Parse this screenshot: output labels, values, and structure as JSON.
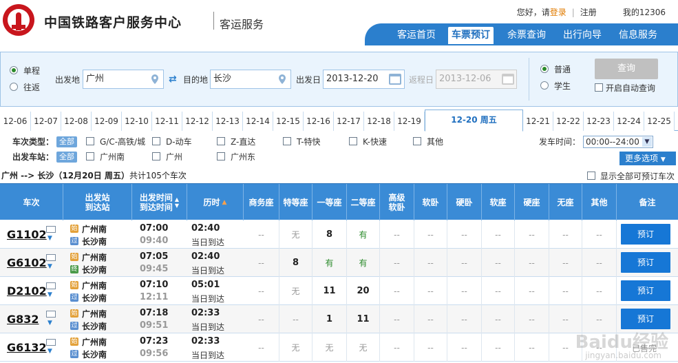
{
  "header": {
    "site_title": "中国铁路客户服务中心",
    "site_sub": "客运服务",
    "greeting": "您好，请",
    "login": "登录",
    "register": "注册",
    "my_account": "我的12306",
    "nav": [
      "客运首页",
      "车票预订",
      "余票查询",
      "出行向导",
      "信息服务"
    ],
    "active_nav": "车票预订"
  },
  "query": {
    "trip_oneway": "单程",
    "trip_round": "往返",
    "from_label": "出发地",
    "from_value": "广州",
    "to_label": "目的地",
    "to_value": "长沙",
    "date_label": "出发日",
    "date_value": "2013-12-20",
    "return_label": "返程日",
    "return_value": "2013-12-06",
    "type_normal": "普通",
    "type_student": "学生",
    "query_button": "查询",
    "auto_query": "开启自动查询"
  },
  "dates": [
    "12-06",
    "12-07",
    "12-08",
    "12-09",
    "12-10",
    "12-11",
    "12-12",
    "12-13",
    "12-14",
    "12-15",
    "12-16",
    "12-17",
    "12-18",
    "12-19",
    "12-20 周五",
    "12-21",
    "12-22",
    "12-23",
    "12-24",
    "12-25"
  ],
  "active_date": "12-20 周五",
  "filters": {
    "type_label": "车次类型：",
    "station_label": "出发车站：",
    "all": "全部",
    "types": [
      "G/C-高铁/城",
      "D-动车",
      "Z-直达",
      "T-特快",
      "K-快速",
      "其他"
    ],
    "stations": [
      "广州南",
      "广州",
      "广州东"
    ],
    "time_label": "发车时间：",
    "time_value": "00:00--24:00",
    "more": "更多选项"
  },
  "summary": {
    "route": "广州 --> 长沙（12月20日  周五）",
    "count": "共计105个车次",
    "show_all": "显示全部可预订车次"
  },
  "table": {
    "headers": {
      "train": "车次",
      "station": "出发站\n到达站",
      "time": "出发时间\n到达时间",
      "duration": "历时",
      "business": "商务座",
      "special": "特等座",
      "first": "一等座",
      "second": "二等座",
      "adv_soft": "高级\n软卧",
      "soft_sleep": "软卧",
      "hard_sleep": "硬卧",
      "soft_seat": "软座",
      "hard_seat": "硬座",
      "no_seat": "无座",
      "other": "其他",
      "remark": "备注"
    },
    "rows": [
      {
        "train": "G1102",
        "from": "广州南",
        "to": "长沙南",
        "from_badge": "始",
        "to_badge": "过",
        "dep": "07:00",
        "arr": "09:40",
        "duration": "02:40",
        "dur_note": "当日到达",
        "seats": [
          "--",
          "无",
          "8",
          "有",
          "--",
          "--",
          "--",
          "--",
          "--",
          "--",
          "--"
        ],
        "action": "预订"
      },
      {
        "train": "G6102",
        "from": "广州南",
        "to": "长沙南",
        "from_badge": "始",
        "to_badge": "终",
        "dep": "07:05",
        "arr": "09:45",
        "duration": "02:40",
        "dur_note": "当日到达",
        "seats": [
          "--",
          "8",
          "有",
          "有",
          "--",
          "--",
          "--",
          "--",
          "--",
          "--",
          "--"
        ],
        "action": "预订"
      },
      {
        "train": "D2102",
        "from": "广州南",
        "to": "长沙南",
        "from_badge": "始",
        "to_badge": "过",
        "dep": "07:10",
        "arr": "12:11",
        "duration": "05:01",
        "dur_note": "当日到达",
        "seats": [
          "--",
          "无",
          "11",
          "20",
          "--",
          "--",
          "--",
          "--",
          "--",
          "--",
          "--"
        ],
        "action": "预订"
      },
      {
        "train": "G832",
        "from": "广州南",
        "to": "长沙南",
        "from_badge": "始",
        "to_badge": "过",
        "dep": "07:18",
        "arr": "09:51",
        "duration": "02:33",
        "dur_note": "当日到达",
        "seats": [
          "--",
          "--",
          "1",
          "11",
          "--",
          "--",
          "--",
          "--",
          "--",
          "--",
          "--"
        ],
        "action": "预订"
      },
      {
        "train": "G6132",
        "from": "广州南",
        "to": "长沙南",
        "from_badge": "始",
        "to_badge": "过",
        "dep": "07:23",
        "arr": "09:56",
        "duration": "02:33",
        "dur_note": "当日到达",
        "seats": [
          "--",
          "无",
          "无",
          "无",
          "--",
          "--",
          "--",
          "--",
          "--",
          "--",
          "--"
        ],
        "action": "已售完"
      }
    ]
  },
  "watermark": "Baidu经验",
  "watermark_url": "jingyan.baidu.com",
  "colors": {
    "nav": "#2b7fcd",
    "book": "#1677d6",
    "logo": "#c8161d",
    "have": "#2a8a2a"
  }
}
